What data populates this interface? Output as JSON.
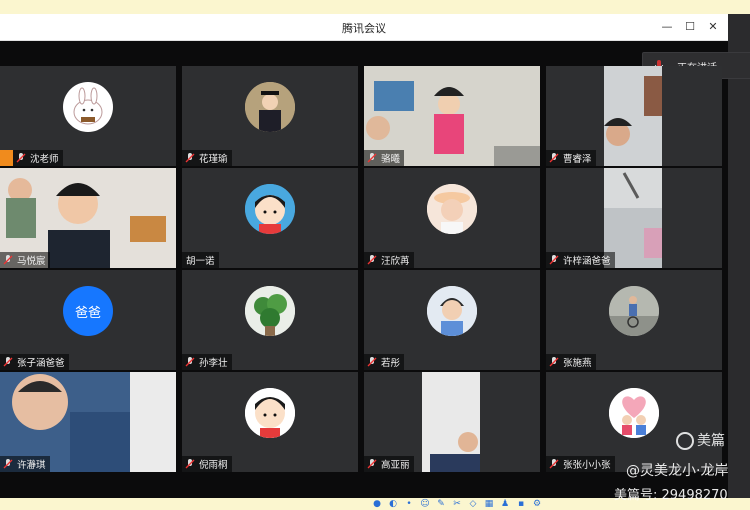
{
  "window": {
    "title": "腾讯会议",
    "minimize": "—",
    "maximize": "☐",
    "close": "✕"
  },
  "speaking": {
    "label": "正在讲话:"
  },
  "participants": [
    {
      "name": "沈老师",
      "host": true
    },
    {
      "name": "花瑾瑜"
    },
    {
      "name": "骆曦"
    },
    {
      "name": "曹睿泽"
    },
    {
      "name": "马悦宸"
    },
    {
      "name": "胡一诺"
    },
    {
      "name": "汪欣苒"
    },
    {
      "name": "许梓涵爸爸"
    },
    {
      "name": "张子涵爸爸",
      "avatar_text": "爸爸"
    },
    {
      "name": "孙李壮"
    },
    {
      "name": "若彤"
    },
    {
      "name": "张施燕"
    },
    {
      "name": "许瀞琪"
    },
    {
      "name": "倪雨桐"
    },
    {
      "name": "高亚丽"
    },
    {
      "name": "张张小小张"
    }
  ],
  "watermark": {
    "brand": "美篇",
    "author": "@灵美龙小·龙岸",
    "id_line": "美篇号: 29498270"
  },
  "colors": {
    "tile_bg": "#2e2f31",
    "avatar_blue": "#1677ff",
    "host_orange": "#f08b1d"
  }
}
